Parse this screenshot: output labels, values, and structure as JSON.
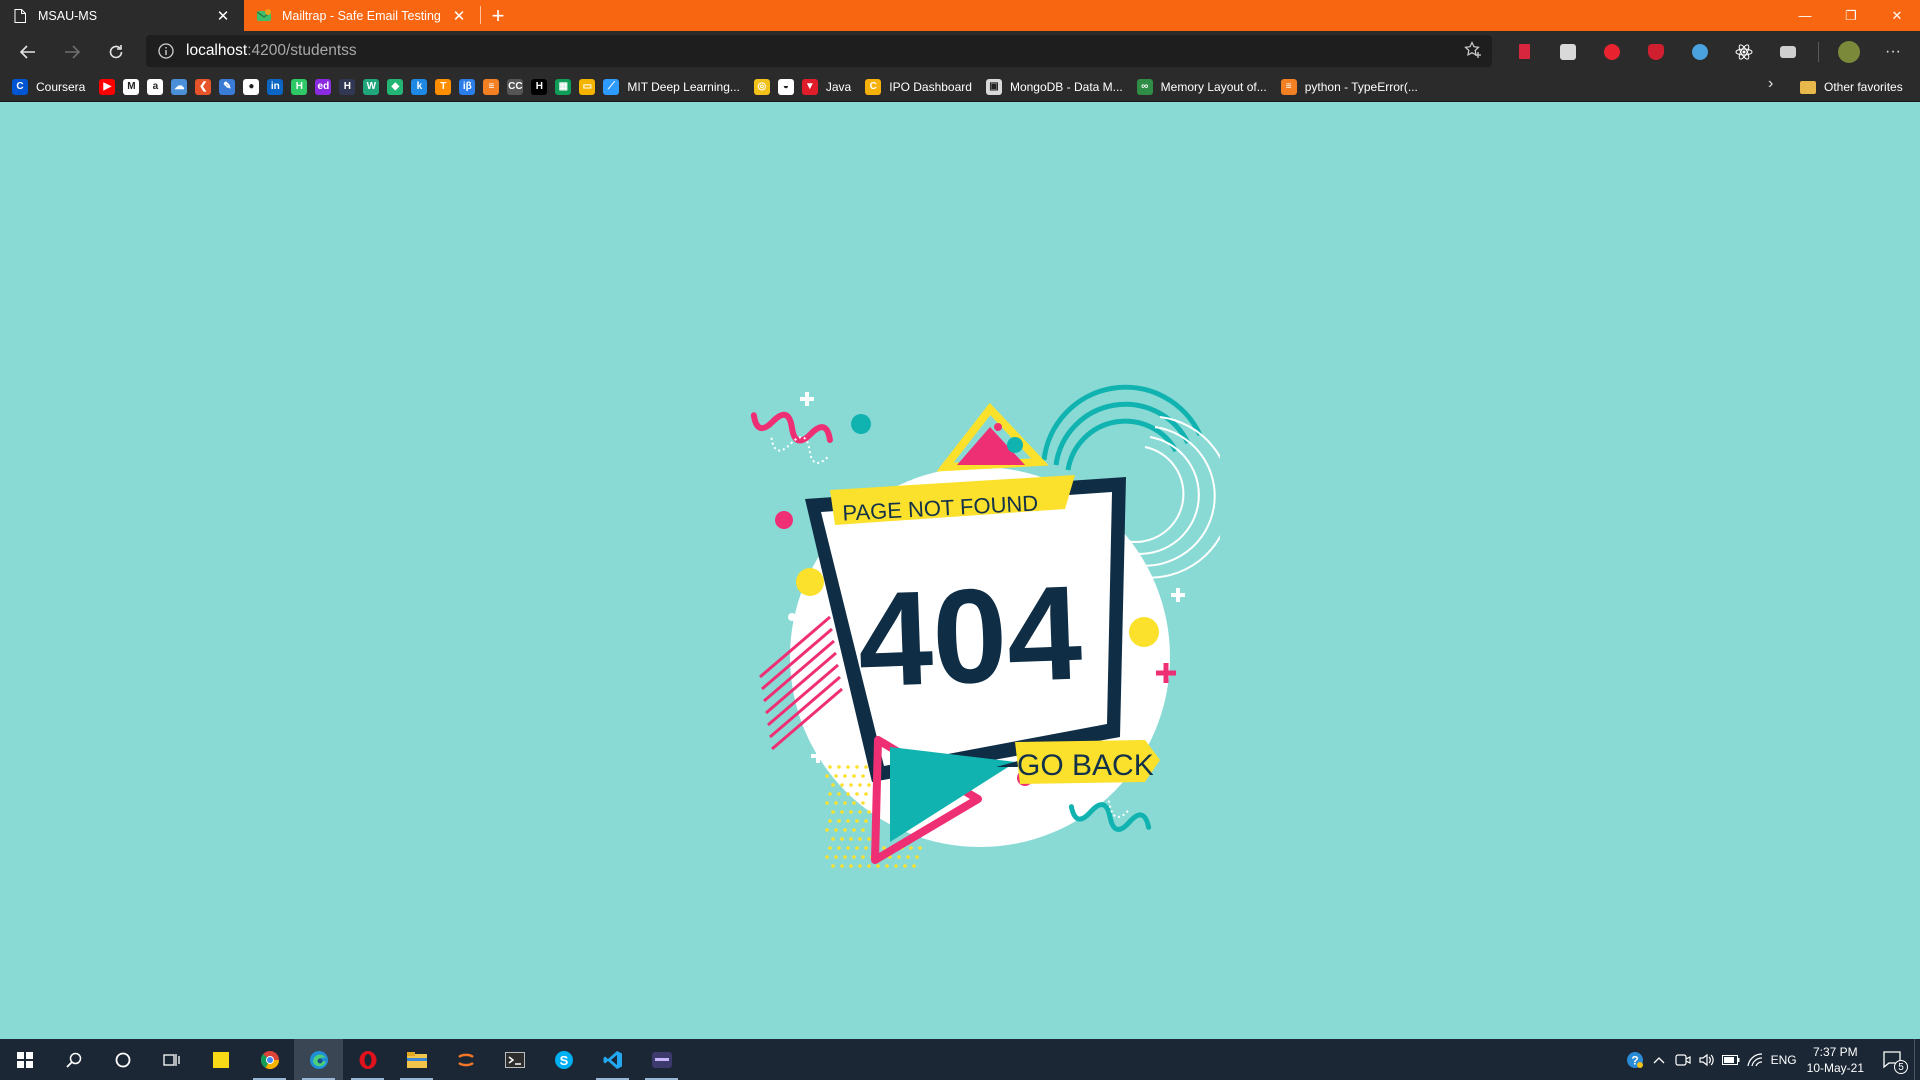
{
  "browser": {
    "tabs": [
      {
        "title": "MSAU-MS",
        "active": true
      },
      {
        "title": "Mailtrap - Safe Email Testing",
        "active": false
      }
    ],
    "new_tab_label": "+",
    "address": {
      "host": "localhost",
      "path": ":4200/studentss"
    },
    "bookmarks": [
      {
        "label": "Coursera",
        "icon": "coursera-icon",
        "color": "#0056d2",
        "glyph": "C"
      },
      {
        "label": "",
        "icon": "youtube-icon",
        "color": "#ff0000",
        "glyph": "▶"
      },
      {
        "label": "",
        "icon": "gmail-icon",
        "color": "#ffffff",
        "glyph": "M"
      },
      {
        "label": "",
        "icon": "amazon-icon",
        "color": "#ffffff",
        "glyph": "a"
      },
      {
        "label": "",
        "icon": "cloud-icon",
        "color": "#4a90d9",
        "glyph": "☁"
      },
      {
        "label": "",
        "icon": "codechef-icon",
        "color": "#e8542a",
        "glyph": "❮"
      },
      {
        "label": "",
        "icon": "edit-icon",
        "color": "#3a7bd5",
        "glyph": "✎"
      },
      {
        "label": "",
        "icon": "github-icon",
        "color": "#ffffff",
        "glyph": "●"
      },
      {
        "label": "",
        "icon": "linkedin-icon",
        "color": "#0a66c2",
        "glyph": "in"
      },
      {
        "label": "",
        "icon": "hackerrank-icon",
        "color": "#2ec866",
        "glyph": "H"
      },
      {
        "label": "",
        "icon": "edx-icon",
        "color": "#8a2be2",
        "glyph": "ed"
      },
      {
        "label": "",
        "icon": "hackerearth-icon",
        "color": "#323754",
        "glyph": "H"
      },
      {
        "label": "",
        "icon": "w-icon",
        "color": "#1fa67a",
        "glyph": "W"
      },
      {
        "label": "",
        "icon": "leaf-icon",
        "color": "#22b573",
        "glyph": "◆"
      },
      {
        "label": "",
        "icon": "k-icon",
        "color": "#1e88e5",
        "glyph": "k"
      },
      {
        "label": "",
        "icon": "tensorflow-icon",
        "color": "#ff8f00",
        "glyph": "T"
      },
      {
        "label": "",
        "icon": "ibeta-icon",
        "color": "#2b7de9",
        "glyph": "iβ"
      },
      {
        "label": "",
        "icon": "stackoverflow-icon",
        "color": "#f48024",
        "glyph": "≡"
      },
      {
        "label": "",
        "icon": "cc-icon",
        "color": "#555555",
        "glyph": "CC"
      },
      {
        "label": "",
        "icon": "hackernoon-icon",
        "color": "#000000",
        "glyph": "H"
      },
      {
        "label": "",
        "icon": "sheets-icon",
        "color": "#0f9d58",
        "glyph": "▦"
      },
      {
        "label": "",
        "icon": "slides-icon",
        "color": "#f4b400",
        "glyph": "▭"
      },
      {
        "label": "MIT Deep Learning...",
        "icon": "share-icon",
        "color": "#2e9bff",
        "glyph": "⟋"
      },
      {
        "label": "",
        "icon": "circle-icon",
        "color": "#f2c21a",
        "glyph": "◎"
      },
      {
        "label": "",
        "icon": "mask-icon",
        "color": "#ffffff",
        "glyph": "◒"
      },
      {
        "label": "Java",
        "icon": "java-icon",
        "color": "#e11d2a",
        "glyph": "▼"
      },
      {
        "label": "IPO Dashboard",
        "icon": "ipo-icon",
        "color": "#f6b10a",
        "glyph": "C"
      },
      {
        "label": "MongoDB - Data M...",
        "icon": "mongodb-icon",
        "color": "#d9d9d9",
        "glyph": "▣"
      },
      {
        "label": "Memory Layout of...",
        "icon": "gfg-icon",
        "color": "#2f8d46",
        "glyph": "∞"
      },
      {
        "label": "python - TypeError(...",
        "icon": "stackoverflow-icon",
        "color": "#f48024",
        "glyph": "≡"
      }
    ],
    "other_favorites": "Other favorites"
  },
  "page": {
    "not_found_label": "PAGE NOT FOUND",
    "error_code": "404",
    "go_back_label": "GO BACK"
  },
  "colors": {
    "background": "#89dad5",
    "navy": "#0f2d44",
    "pink": "#ef2f74",
    "yellow": "#fbe02c",
    "teal": "#11b3b0",
    "titlebar": "#f96611"
  },
  "taskbar": {
    "apps": [
      {
        "name": "windows-start-icon",
        "open": false,
        "active": false
      },
      {
        "name": "search-icon",
        "open": false,
        "active": false
      },
      {
        "name": "cortana-icon",
        "open": false,
        "active": false
      },
      {
        "name": "task-view-icon",
        "open": false,
        "active": false
      },
      {
        "name": "sticky-notes-icon",
        "open": false,
        "active": false
      },
      {
        "name": "chrome-icon",
        "open": true,
        "active": false
      },
      {
        "name": "edge-icon",
        "open": true,
        "active": true
      },
      {
        "name": "opera-icon",
        "open": true,
        "active": false
      },
      {
        "name": "file-explorer-icon",
        "open": true,
        "active": false
      },
      {
        "name": "jupyter-icon",
        "open": false,
        "active": false
      },
      {
        "name": "terminal-icon",
        "open": false,
        "active": false
      },
      {
        "name": "skype-icon",
        "open": false,
        "active": false
      },
      {
        "name": "vscode-icon",
        "open": true,
        "active": false
      },
      {
        "name": "app-icon",
        "open": true,
        "active": false
      }
    ],
    "language": "ENG",
    "time": "7:37 PM",
    "date": "10-May-21",
    "notification_count": "5"
  }
}
